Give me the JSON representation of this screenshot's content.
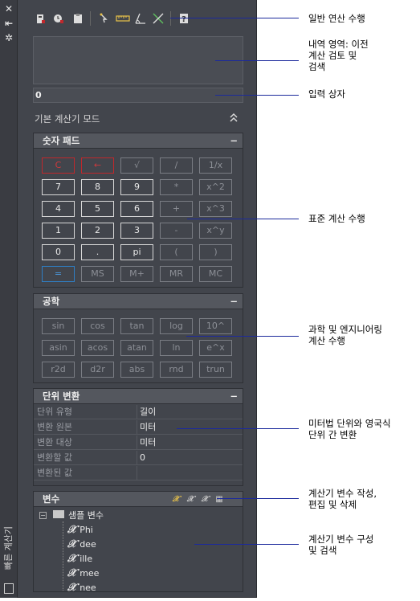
{
  "titlebar": {
    "vertical_title": "빠른 계산기",
    "icons": [
      "close-icon",
      "auto-hide-icon",
      "properties-icon",
      "calculator-icon"
    ]
  },
  "toolbar": {
    "tools": [
      "clear-icon",
      "clear-history-icon",
      "paste-icon",
      "get-coordinates-icon",
      "distance-icon",
      "angle-icon",
      "intersection-icon",
      "help-icon"
    ]
  },
  "input": {
    "value": "0"
  },
  "mode": {
    "label": "기본 계산기 모드",
    "chevron": "⌃"
  },
  "numpad": {
    "title": "숫자 패드",
    "collapse": "−",
    "rows": [
      [
        {
          "label": "C",
          "style": "red"
        },
        {
          "label": "←",
          "style": "red"
        },
        {
          "label": "√",
          "style": "dim"
        },
        {
          "label": "/",
          "style": "dim"
        },
        {
          "label": "1/x",
          "style": "dim"
        }
      ],
      [
        {
          "label": "7",
          "style": "hi"
        },
        {
          "label": "8",
          "style": "hi"
        },
        {
          "label": "9",
          "style": "hi"
        },
        {
          "label": "*",
          "style": "dim"
        },
        {
          "label": "x^2",
          "style": "dim"
        }
      ],
      [
        {
          "label": "4",
          "style": "hi"
        },
        {
          "label": "5",
          "style": "hi"
        },
        {
          "label": "6",
          "style": "hi"
        },
        {
          "label": "+",
          "style": "dim"
        },
        {
          "label": "x^3",
          "style": "dim"
        }
      ],
      [
        {
          "label": "1",
          "style": "hi"
        },
        {
          "label": "2",
          "style": "hi"
        },
        {
          "label": "3",
          "style": "hi"
        },
        {
          "label": "-",
          "style": "dim"
        },
        {
          "label": "x^y",
          "style": "dim"
        }
      ],
      [
        {
          "label": "0",
          "style": "hi"
        },
        {
          "label": ".",
          "style": "hi"
        },
        {
          "label": "pi",
          "style": "hi"
        },
        {
          "label": "(",
          "style": "dim"
        },
        {
          "label": ")",
          "style": "dim"
        }
      ],
      [
        {
          "label": "=",
          "style": "blue"
        },
        {
          "label": "MS",
          "style": "dim"
        },
        {
          "label": "M+",
          "style": "dim"
        },
        {
          "label": "MR",
          "style": "dim"
        },
        {
          "label": "MC",
          "style": "dim"
        }
      ]
    ]
  },
  "science": {
    "title": "공학",
    "collapse": "−",
    "rows": [
      [
        "sin",
        "cos",
        "tan",
        "log",
        "10^"
      ],
      [
        "asin",
        "acos",
        "atan",
        "ln",
        "e^x"
      ],
      [
        "r2d",
        "d2r",
        "abs",
        "rnd",
        "trun"
      ]
    ]
  },
  "units": {
    "title": "단위 변환",
    "collapse": "−",
    "rows": [
      {
        "label": "단위 유형",
        "value": "길이"
      },
      {
        "label": "변환 원본",
        "value": "미터"
      },
      {
        "label": "변환 대상",
        "value": "미터"
      },
      {
        "label": "변환할 값",
        "value": "0"
      },
      {
        "label": "변환된 값",
        "value": ""
      }
    ]
  },
  "variables": {
    "title": "변수",
    "tools": [
      "new-variable-icon",
      "edit-variable-icon",
      "delete-variable-icon",
      "calculator-icon"
    ],
    "category": "샘플 변수",
    "category_toggle": "−",
    "items": [
      "Phi",
      "dee",
      "ille",
      "mee",
      "nee"
    ]
  },
  "callouts": [
    "일반 연산 수행",
    "내역 영역: 이전\n계산 검토 및\n검색",
    "입력 상자",
    "표준 계산 수행",
    "과학 및 엔지니어링\n계산 수행",
    "미터법 단위와 영국식\n단위 간 변환",
    "계산기 변수 작성,\n편집 및 삭제",
    "계산기 변수 구성\n및 검색"
  ],
  "colors": {
    "panel": "#42454c",
    "section_header": "#54575e",
    "callout_line": "#1c2a9c",
    "clear_button": "#c0282c",
    "equals_button": "#2f7fc4"
  }
}
